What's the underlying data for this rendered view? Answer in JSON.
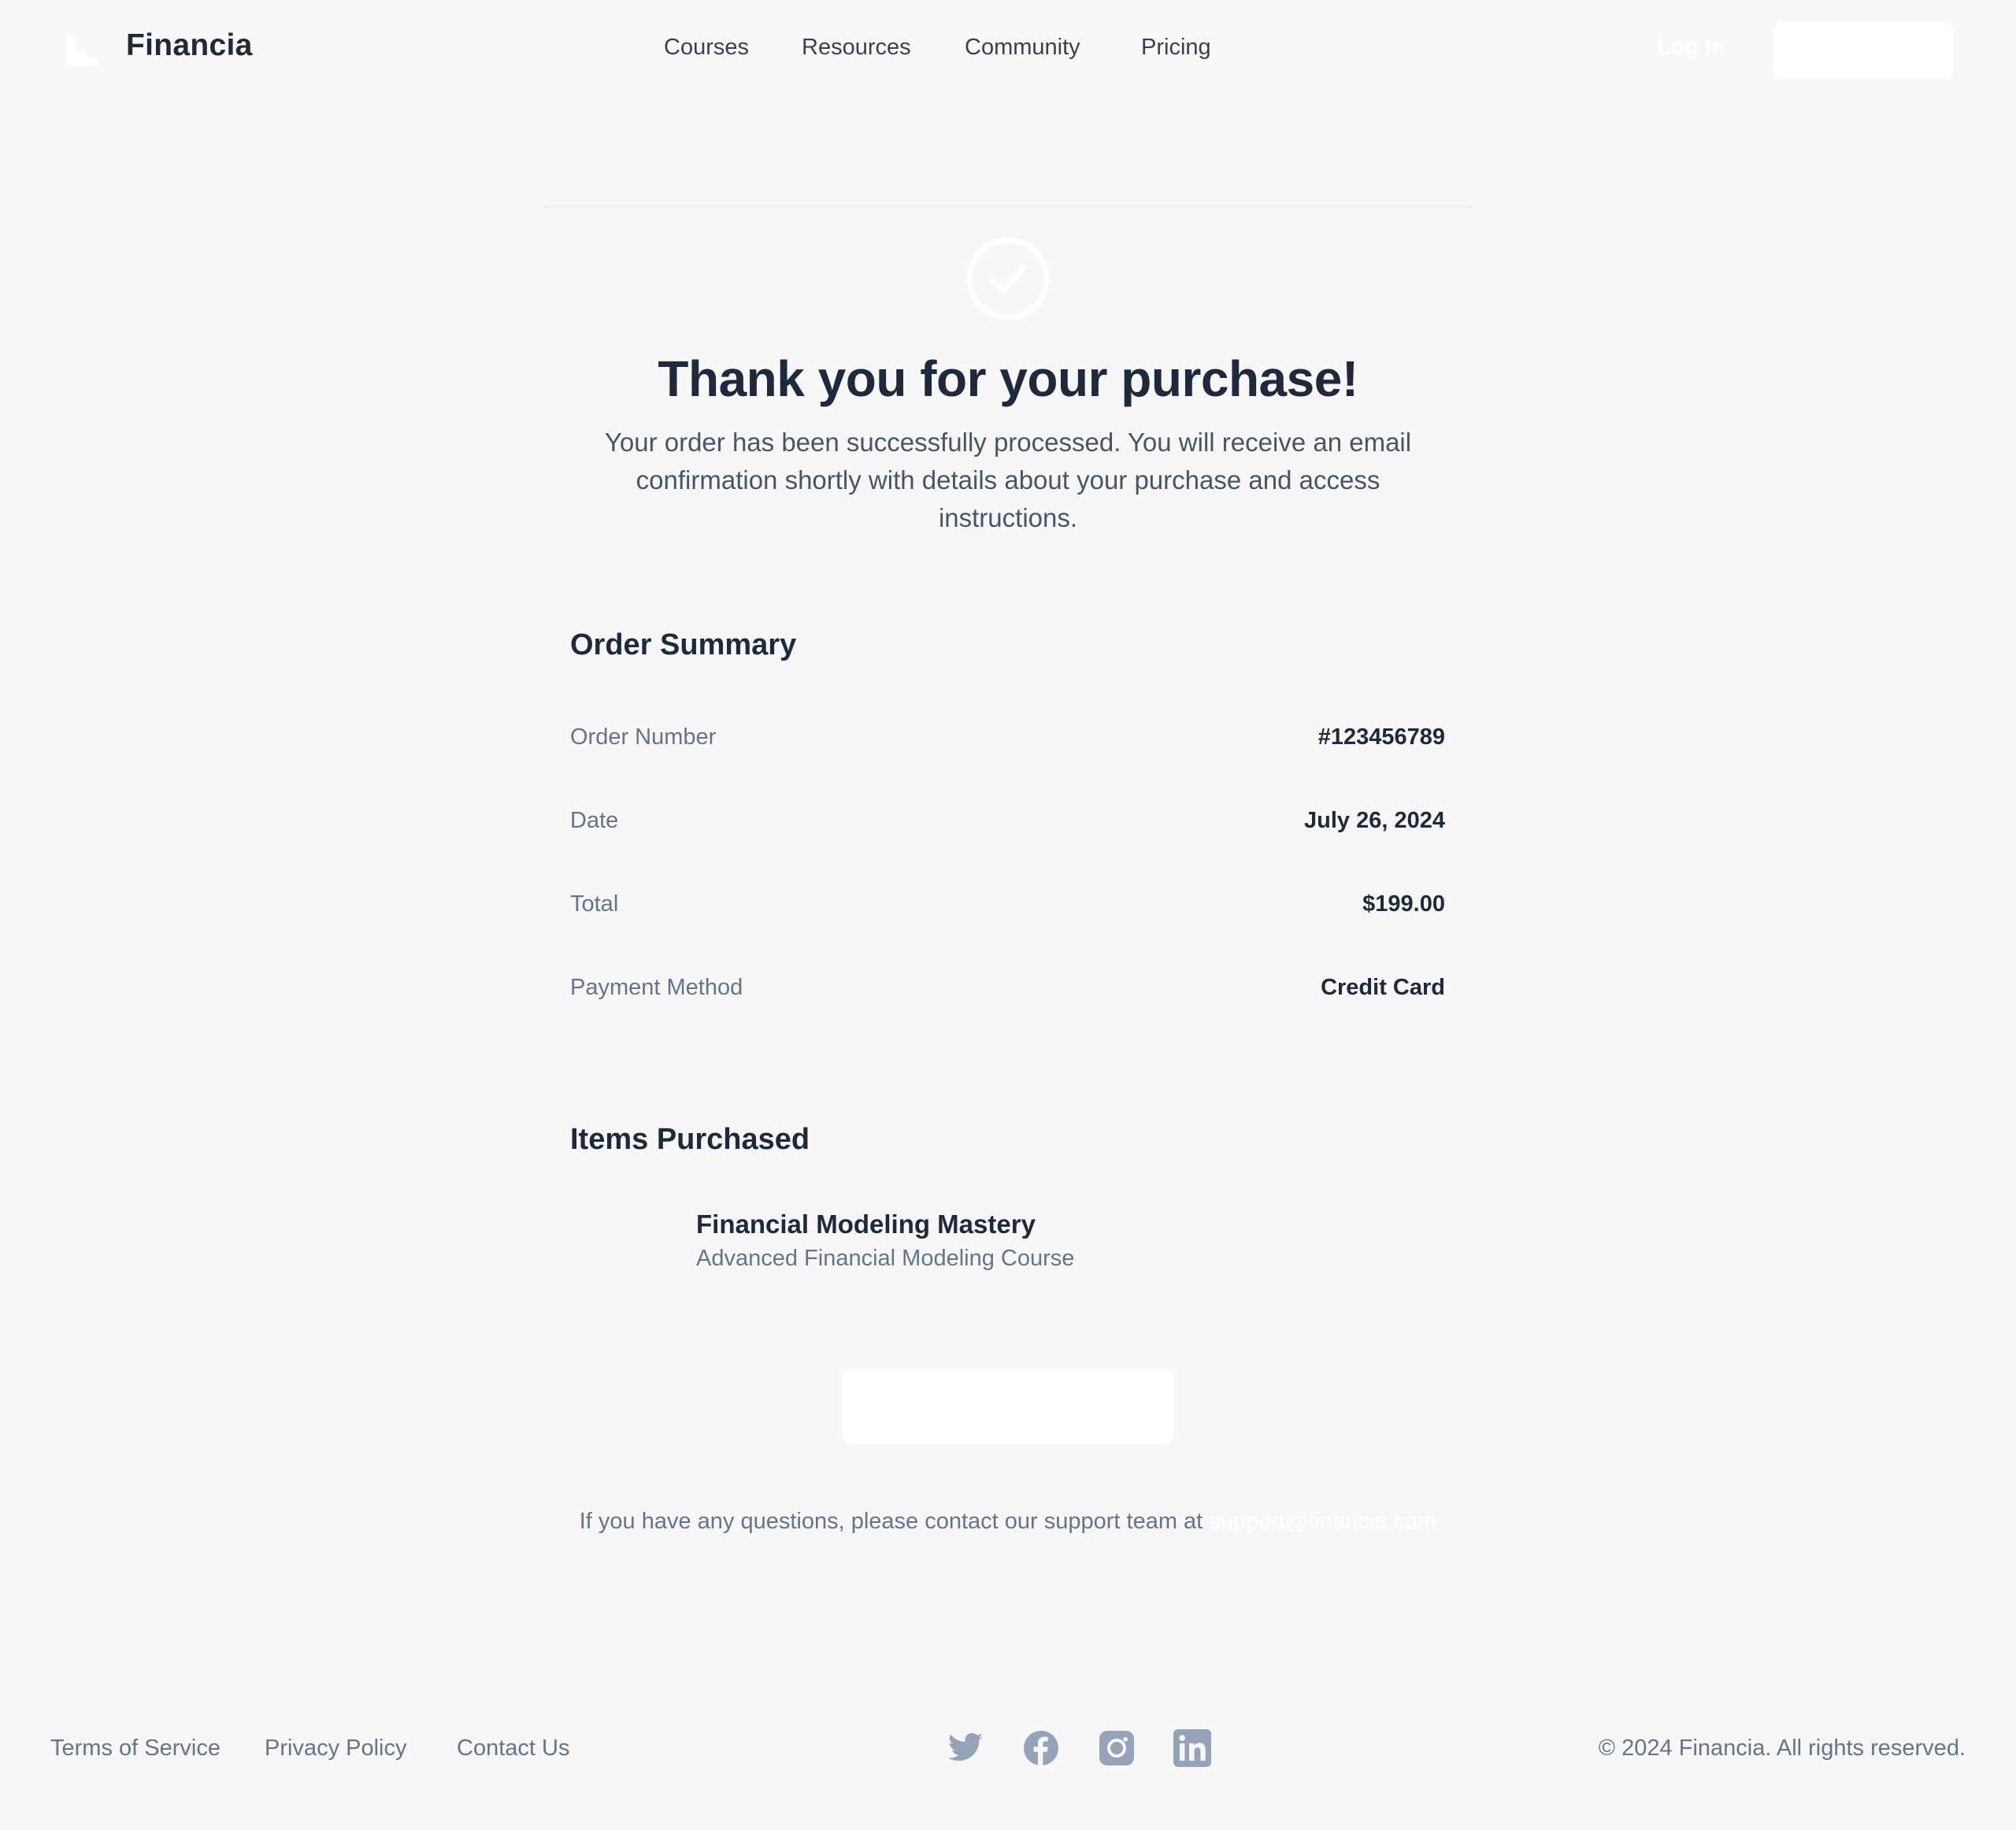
{
  "header": {
    "brand": "Financia",
    "nav": [
      "Courses",
      "Resources",
      "Community",
      "Pricing"
    ],
    "login_label": "Log In"
  },
  "confirmation": {
    "title": "Thank you for your purchase!",
    "message": "Your order has been successfully processed. You will receive an email confirmation shortly with details about your purchase and access instructions."
  },
  "order_summary": {
    "heading": "Order Summary",
    "rows": [
      {
        "label": "Order Number",
        "value": "#123456789"
      },
      {
        "label": "Date",
        "value": "July 26, 2024"
      },
      {
        "label": "Total",
        "value": "$199.00"
      },
      {
        "label": "Payment Method",
        "value": "Credit Card"
      }
    ]
  },
  "items_purchased": {
    "heading": "Items Purchased",
    "items": [
      {
        "name": "Financial Modeling Mastery",
        "description": "Advanced Financial Modeling Course"
      }
    ]
  },
  "support": {
    "text": "If you have any questions, please contact our support team at",
    "email": "support@financia.com"
  },
  "footer": {
    "links": [
      "Terms of Service",
      "Privacy Policy",
      "Contact Us"
    ],
    "social_icons": [
      "twitter-icon",
      "facebook-icon",
      "instagram-icon",
      "linkedin-icon"
    ],
    "copyright": "© 2024 Financia. All rights reserved."
  },
  "colors": {
    "background": "#f7f7f7",
    "heading": "#1e293b",
    "muted_text": "#64748b",
    "icon_gray": "#94a3b8"
  }
}
